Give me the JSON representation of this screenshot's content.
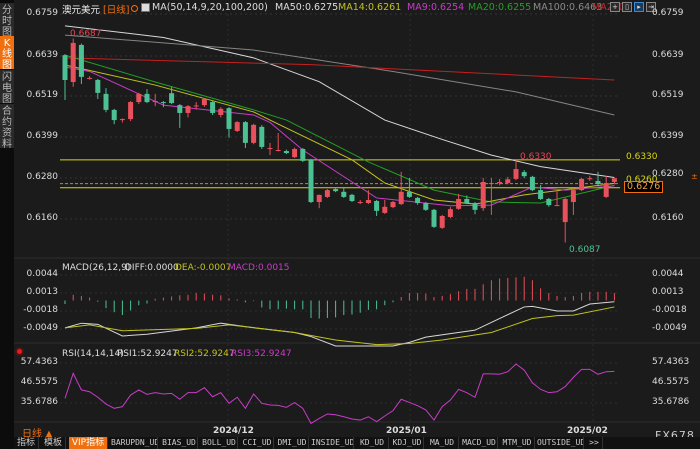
{
  "sidebar": {
    "tabs": [
      {
        "label": "分时图",
        "active": false
      },
      {
        "label": "K线图",
        "active": true
      },
      {
        "label": "闪电图",
        "active": false
      },
      {
        "label": "合约资料",
        "active": false
      }
    ]
  },
  "header": {
    "symbol": "澳元美元",
    "period": "[日线]",
    "ma_params": "MA(50,14,9,20,100,200)",
    "ma50": "MA50:0.6275",
    "ma14": "MA14:0.6261",
    "ma9": "MA9:0.6254",
    "ma20": "MA20:0.6255",
    "ma100": "MA100:0.6463",
    "ma200": "MA200:"
  },
  "toolbar_icons": [
    "crosshair-icon",
    "range-icon",
    "play-cursor-icon",
    "move-right-icon"
  ],
  "price_axis": {
    "labels": [
      "0.6759",
      "0.6639",
      "0.6519",
      "0.6399",
      "0.6280",
      "0.6160"
    ]
  },
  "annotations": {
    "high_label": "0.6687",
    "peak_label": "0.6330",
    "low_label": "0.6087",
    "hline_upper_label": "0.6330",
    "hline_lower_label": "0.6260",
    "current_price": "0.6276"
  },
  "macd": {
    "title": "MACD(26,12,9)",
    "diff_label": "DIFF:0.0000",
    "dea_label": "DEA:-0.0007",
    "macd_label": "MACD:0.0015",
    "axis_labels": [
      "0.0044",
      "0.0013",
      "-0.0018",
      "-0.0049"
    ]
  },
  "rsi": {
    "title": "RSI(14,14,14)",
    "rsi1_label": "RSI1:52.9247",
    "rsi2_label": "RSI2:52.9247",
    "rsi3_label": "RSI3:52.9247",
    "axis_labels": [
      "57.4363",
      "46.5575",
      "35.6786"
    ]
  },
  "time_axis": {
    "period_label": "日线 ▲",
    "labels": [
      "2024/12",
      "2025/01",
      "2025/02"
    ]
  },
  "bottom_tabs": [
    "指标",
    "模板",
    "VIP指标",
    "BARUPDN_UD",
    "BIAS_UD",
    "BOLL_UD",
    "CCI_UD",
    "DMI_UD",
    "INSIDE_UD",
    "KD_UD",
    "KDJ_UD",
    "MA_UD",
    "MACD_UD",
    "MTM_UD",
    "OUTSIDE_UD",
    ">>"
  ],
  "brand": "FX678",
  "colors": {
    "up": "#e8505b",
    "down": "#4cc294",
    "accent": "#f07010",
    "ma50": "#d8d8d8",
    "ma14": "#c2c21e",
    "ma9": "#c83cc8",
    "ma20": "#22a022",
    "ma100": "#858585",
    "ma200": "#c42020",
    "hline": "#d6d61a"
  },
  "chart_data": {
    "type": "candlestick",
    "title": "澳元美元 日线",
    "ylim": [
      0.606,
      0.679
    ],
    "candles_ohlc": [
      [
        0.6638,
        0.6641,
        0.6506,
        0.6565
      ],
      [
        0.6559,
        0.6687,
        0.6545,
        0.6674
      ],
      [
        0.6668,
        0.6672,
        0.6553,
        0.6574
      ],
      [
        0.6571,
        0.6576,
        0.6566,
        0.6571
      ],
      [
        0.6565,
        0.6568,
        0.6509,
        0.6527
      ],
      [
        0.6524,
        0.6541,
        0.647,
        0.6477
      ],
      [
        0.6477,
        0.648,
        0.6435,
        0.6447
      ],
      [
        0.6447,
        0.6452,
        0.644,
        0.645
      ],
      [
        0.645,
        0.6503,
        0.6444,
        0.65
      ],
      [
        0.65,
        0.6527,
        0.6494,
        0.6524
      ],
      [
        0.6524,
        0.6538,
        0.6497,
        0.65
      ],
      [
        0.65,
        0.6524,
        0.6488,
        0.6503
      ],
      [
        0.65,
        0.6503,
        0.6485,
        0.6497
      ],
      [
        0.6526,
        0.6545,
        0.6494,
        0.6497
      ],
      [
        0.6491,
        0.6494,
        0.6424,
        0.6468
      ],
      [
        0.6468,
        0.6491,
        0.6455,
        0.6488
      ],
      [
        0.6488,
        0.65,
        0.6478,
        0.649
      ],
      [
        0.6491,
        0.6512,
        0.6486,
        0.6509
      ],
      [
        0.65,
        0.6503,
        0.6462,
        0.6468
      ],
      [
        0.6462,
        0.6485,
        0.6455,
        0.648
      ],
      [
        0.6482,
        0.6485,
        0.6395,
        0.6421
      ],
      [
        0.6415,
        0.6444,
        0.6412,
        0.6441
      ],
      [
        0.6441,
        0.6444,
        0.6365,
        0.638
      ],
      [
        0.638,
        0.6436,
        0.6376,
        0.6433
      ],
      [
        0.6427,
        0.6432,
        0.6362,
        0.6368
      ],
      [
        0.6365,
        0.638,
        0.6344,
        0.6365
      ],
      [
        0.6359,
        0.6409,
        0.6355,
        0.6359
      ],
      [
        0.6356,
        0.636,
        0.6347,
        0.635
      ],
      [
        0.6338,
        0.6366,
        0.6335,
        0.6362
      ],
      [
        0.6362,
        0.6365,
        0.6324,
        0.6327
      ],
      [
        0.633,
        0.6333,
        0.6203,
        0.6206
      ],
      [
        0.6206,
        0.6228,
        0.6188,
        0.6227
      ],
      [
        0.6221,
        0.6244,
        0.6218,
        0.6241
      ],
      [
        0.6244,
        0.6247,
        0.6235,
        0.6238
      ],
      [
        0.6236,
        0.625,
        0.6218,
        0.6221
      ],
      [
        0.6227,
        0.623,
        0.6206,
        0.6209
      ],
      [
        0.6206,
        0.6212,
        0.62,
        0.6206
      ],
      [
        0.6203,
        0.6241,
        0.62,
        0.6212
      ],
      [
        0.6209,
        0.6212,
        0.6165,
        0.618
      ],
      [
        0.6174,
        0.6212,
        0.6171,
        0.6192
      ],
      [
        0.6191,
        0.6209,
        0.6188,
        0.6206
      ],
      [
        0.62,
        0.6295,
        0.6197,
        0.6236
      ],
      [
        0.6236,
        0.6277,
        0.6218,
        0.6221
      ],
      [
        0.6218,
        0.6221,
        0.6198,
        0.6203
      ],
      [
        0.6203,
        0.6206,
        0.618,
        0.6183
      ],
      [
        0.6183,
        0.6186,
        0.613,
        0.6133
      ],
      [
        0.613,
        0.6168,
        0.6127,
        0.6165
      ],
      [
        0.6162,
        0.6191,
        0.6159,
        0.6185
      ],
      [
        0.6186,
        0.623,
        0.6183,
        0.6215
      ],
      [
        0.6215,
        0.6225,
        0.62,
        0.6203
      ],
      [
        0.6203,
        0.6206,
        0.617,
        0.6183
      ],
      [
        0.6188,
        0.6277,
        0.618,
        0.6265
      ],
      [
        0.6262,
        0.6277,
        0.6168,
        0.6262
      ],
      [
        0.6264,
        0.6274,
        0.6255,
        0.6265
      ],
      [
        0.6262,
        0.628,
        0.6258,
        0.6273
      ],
      [
        0.6274,
        0.633,
        0.627,
        0.6303
      ],
      [
        0.6294,
        0.63,
        0.6276,
        0.6282
      ],
      [
        0.628,
        0.6283,
        0.6238,
        0.6241
      ],
      [
        0.6241,
        0.6256,
        0.6212,
        0.6215
      ],
      [
        0.6215,
        0.6218,
        0.6192,
        0.6197
      ],
      [
        0.6197,
        0.6241,
        0.6194,
        0.6197
      ],
      [
        0.6147,
        0.6218,
        0.6087,
        0.6215
      ],
      [
        0.6206,
        0.6247,
        0.6168,
        0.6241
      ],
      [
        0.6241,
        0.6277,
        0.6238,
        0.6274
      ],
      [
        0.6274,
        0.6283,
        0.6268,
        0.6276
      ],
      [
        0.6268,
        0.6295,
        0.6256,
        0.6259
      ],
      [
        0.6221,
        0.6283,
        0.6218,
        0.6262
      ],
      [
        0.6265,
        0.6272,
        0.6258,
        0.6276
      ]
    ],
    "moving_averages": [
      {
        "name": "MA50",
        "color_key": "ma50",
        "points": [
          [
            0,
            0.6724
          ],
          [
            12,
            0.669
          ],
          [
            23,
            0.663
          ],
          [
            31,
            0.656
          ],
          [
            39,
            0.6447
          ],
          [
            46,
            0.639
          ],
          [
            52,
            0.6344
          ],
          [
            58,
            0.631
          ],
          [
            67,
            0.6278
          ]
        ]
      },
      {
        "name": "MA100",
        "color_key": "ma100",
        "points": [
          [
            0,
            0.6697
          ],
          [
            23,
            0.6653
          ],
          [
            40,
            0.659
          ],
          [
            55,
            0.653
          ],
          [
            67,
            0.6462
          ]
        ]
      },
      {
        "name": "MA200",
        "color_key": "ma200",
        "points": [
          [
            0,
            0.663
          ],
          [
            30,
            0.661
          ],
          [
            67,
            0.6565
          ]
        ]
      },
      {
        "name": "MA20",
        "color_key": "ma20",
        "points": [
          [
            0,
            0.6638
          ],
          [
            11,
            0.6559
          ],
          [
            23,
            0.6477
          ],
          [
            27,
            0.6447
          ],
          [
            37,
            0.6324
          ],
          [
            45,
            0.6241
          ],
          [
            52,
            0.6206
          ],
          [
            58,
            0.6203
          ],
          [
            67,
            0.6255
          ]
        ]
      },
      {
        "name": "MA14",
        "color_key": "ma14",
        "points": [
          [
            0,
            0.6609
          ],
          [
            11,
            0.655
          ],
          [
            23,
            0.6471
          ],
          [
            25,
            0.6447
          ],
          [
            35,
            0.633
          ],
          [
            39,
            0.6262
          ],
          [
            45,
            0.6212
          ],
          [
            50,
            0.62
          ],
          [
            56,
            0.6227
          ],
          [
            67,
            0.6261
          ]
        ]
      },
      {
        "name": "MA9",
        "color_key": "ma9",
        "points": [
          [
            0,
            0.6603
          ],
          [
            3,
            0.659
          ],
          [
            8,
            0.6535
          ],
          [
            12,
            0.6491
          ],
          [
            23,
            0.6462
          ],
          [
            25,
            0.644
          ],
          [
            29,
            0.6359
          ],
          [
            38,
            0.6218
          ],
          [
            47,
            0.6195
          ],
          [
            52,
            0.6197
          ],
          [
            57,
            0.625
          ],
          [
            61,
            0.6241
          ],
          [
            67,
            0.6254
          ]
        ]
      }
    ],
    "horizontal_lines": [
      0.633,
      0.626,
      0.6254
    ],
    "macd_histogram": [
      -0.0006,
      0.001,
      0.0008,
      0.0005,
      -0.0002,
      -0.0013,
      -0.002,
      -0.0025,
      -0.0017,
      -0.0008,
      -0.0005,
      0.0003,
      0.0005,
      0.0007,
      0.0009,
      0.001,
      0.0013,
      0.0012,
      0.001,
      0.0009,
      0.0004,
      0.0002,
      -0.0003,
      -0.0001,
      -0.0012,
      -0.0015,
      -0.0015,
      -0.0014,
      -0.0015,
      -0.0015,
      -0.003,
      -0.0031,
      -0.003,
      -0.0029,
      -0.0025,
      -0.0024,
      -0.0021,
      -0.0016,
      -0.0015,
      -0.0008,
      -0.0003,
      0.0006,
      0.0013,
      0.0013,
      0.0012,
      0.0006,
      0.0008,
      0.0011,
      0.0016,
      0.002,
      0.002,
      0.0028,
      0.0035,
      0.0038,
      0.0039,
      0.004,
      0.0041,
      0.0035,
      0.0021,
      0.0013,
      0.0008,
      0.0006,
      0.0008,
      0.0013,
      0.0015,
      0.0015,
      0.0015,
      0.0013
    ],
    "macd_diff": [
      [
        0,
        -0.0047
      ],
      [
        2,
        -0.0039
      ],
      [
        4,
        -0.0041
      ],
      [
        7,
        -0.0061
      ],
      [
        10,
        -0.0058
      ],
      [
        16,
        -0.0047
      ],
      [
        19,
        -0.0039
      ],
      [
        22,
        -0.0045
      ],
      [
        28,
        -0.0055
      ],
      [
        30,
        -0.0062
      ],
      [
        33,
        -0.0079
      ],
      [
        36,
        -0.0082
      ],
      [
        40,
        -0.008
      ],
      [
        42,
        -0.0072
      ],
      [
        44,
        -0.0063
      ],
      [
        50,
        -0.0051
      ],
      [
        56,
        -0.0011
      ],
      [
        57,
        -0.001
      ],
      [
        60,
        -0.0018
      ],
      [
        62,
        -0.0018
      ],
      [
        64,
        -0.0006
      ],
      [
        67,
        -0.0002
      ]
    ],
    "macd_dea": [
      [
        0,
        -0.0047
      ],
      [
        3,
        -0.0042
      ],
      [
        7,
        -0.0052
      ],
      [
        16,
        -0.0048
      ],
      [
        20,
        -0.0042
      ],
      [
        28,
        -0.0055
      ],
      [
        33,
        -0.0068
      ],
      [
        38,
        -0.0076
      ],
      [
        42,
        -0.0074
      ],
      [
        46,
        -0.0068
      ],
      [
        52,
        -0.0055
      ],
      [
        57,
        -0.0031
      ],
      [
        60,
        -0.0026
      ],
      [
        62,
        -0.0025
      ],
      [
        67,
        -0.0011
      ]
    ],
    "rsi_values": [
      38.2,
      51.8,
      42.8,
      41.8,
      38.8,
      35.1,
      32.8,
      33.7,
      40.0,
      42.8,
      40.4,
      41.3,
      40.6,
      40.9,
      37.7,
      41.3,
      41.3,
      44.0,
      39.1,
      41.3,
      35.5,
      38.8,
      32.8,
      40.6,
      35.5,
      34.6,
      34.4,
      33.3,
      35.9,
      32.8,
      24.6,
      27.3,
      29.7,
      29.3,
      28.2,
      27.0,
      26.4,
      28.2,
      25.5,
      28.6,
      31.5,
      37.7,
      36.0,
      34.2,
      31.9,
      26.4,
      33.7,
      37.3,
      43.1,
      41.3,
      38.8,
      51.5,
      51.5,
      51.3,
      52.7,
      56.9,
      53.6,
      46.7,
      43.1,
      41.3,
      41.8,
      44.6,
      49.6,
      54.0,
      54.0,
      51.3,
      52.7,
      52.9
    ]
  }
}
